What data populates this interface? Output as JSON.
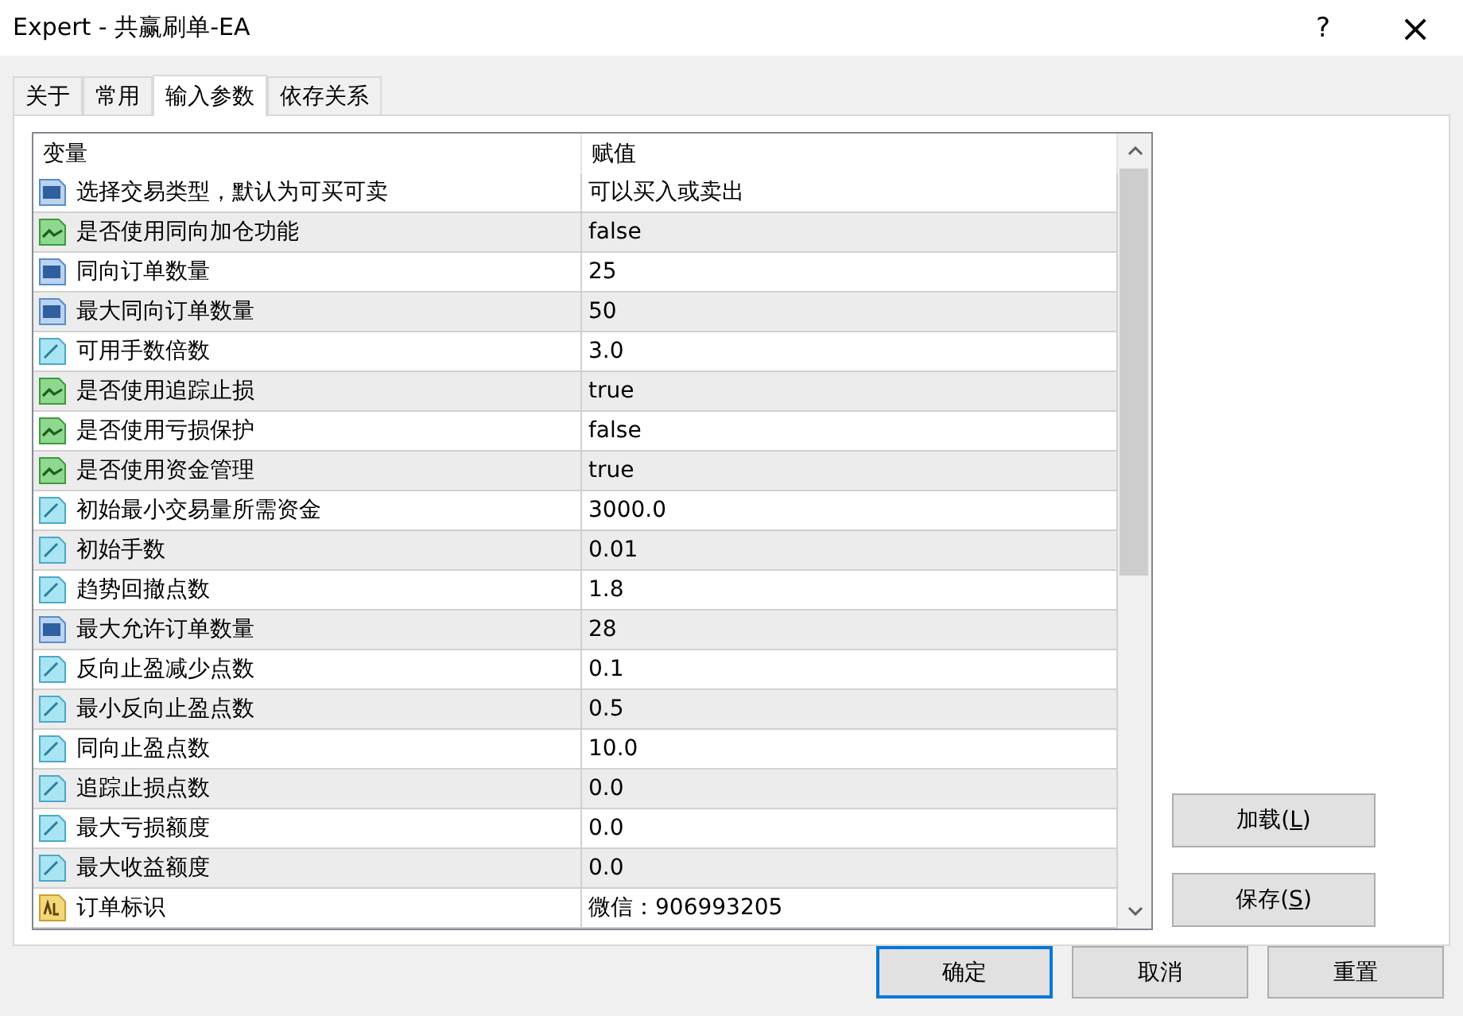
{
  "window": {
    "title": "Expert - 共赢刷单-EA",
    "help": "?",
    "close": "×"
  },
  "tabs": [
    {
      "label": "关于",
      "selected": false
    },
    {
      "label": "常用",
      "selected": false
    },
    {
      "label": "输入参数",
      "selected": true
    },
    {
      "label": "依存关系",
      "selected": false
    }
  ],
  "table": {
    "columns": [
      "变量",
      "赋值"
    ],
    "rows": [
      {
        "kind": "int",
        "name": "选择交易类型，默认为可买可卖",
        "value": "可以买入或卖出"
      },
      {
        "kind": "bool",
        "name": "是否使用同向加仓功能",
        "value": "false"
      },
      {
        "kind": "int",
        "name": "同向订单数量",
        "value": "25"
      },
      {
        "kind": "int",
        "name": "最大同向订单数量",
        "value": "50"
      },
      {
        "kind": "double",
        "name": "可用手数倍数",
        "value": "3.0"
      },
      {
        "kind": "bool",
        "name": "是否使用追踪止损",
        "value": "true"
      },
      {
        "kind": "bool",
        "name": "是否使用亏损保护",
        "value": "false"
      },
      {
        "kind": "bool",
        "name": "是否使用资金管理",
        "value": "true"
      },
      {
        "kind": "double",
        "name": "初始最小交易量所需资金",
        "value": "3000.0"
      },
      {
        "kind": "double",
        "name": "初始手数",
        "value": "0.01"
      },
      {
        "kind": "double",
        "name": "趋势回撤点数",
        "value": "1.8"
      },
      {
        "kind": "int",
        "name": "最大允许订单数量",
        "value": "28"
      },
      {
        "kind": "double",
        "name": "反向止盈减少点数",
        "value": "0.1"
      },
      {
        "kind": "double",
        "name": "最小反向止盈点数",
        "value": "0.5"
      },
      {
        "kind": "double",
        "name": "同向止盈点数",
        "value": "10.0"
      },
      {
        "kind": "double",
        "name": "追踪止损点数",
        "value": "0.0"
      },
      {
        "kind": "double",
        "name": "最大亏损额度",
        "value": "0.0"
      },
      {
        "kind": "double",
        "name": "最大收益额度",
        "value": "0.0"
      },
      {
        "kind": "string",
        "name": "订单标识",
        "value": "微信：906993205"
      }
    ]
  },
  "side_buttons": [
    {
      "label": "加载(**L**)"
    },
    {
      "label": "保存(**S**)"
    }
  ],
  "footer_buttons": [
    {
      "label": "确定",
      "default": true
    },
    {
      "label": "取消",
      "default": false
    },
    {
      "label": "重置",
      "default": false
    }
  ]
}
